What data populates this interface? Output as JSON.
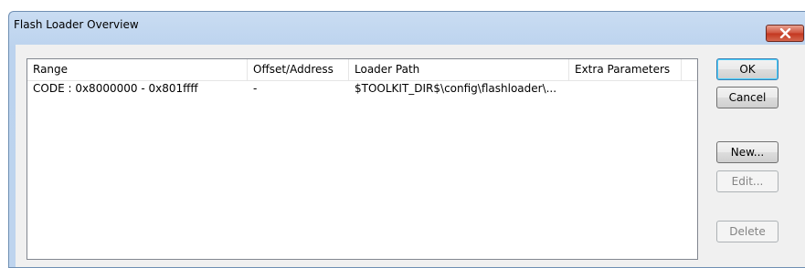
{
  "window": {
    "title": "Flash Loader Overview"
  },
  "list": {
    "columns": [
      "Range",
      "Offset/Address",
      "Loader Path",
      "Extra Parameters"
    ],
    "rows": [
      {
        "range": "CODE : 0x8000000 - 0x801ffff",
        "offset": "-",
        "loader_path": "$TOOLKIT_DIR$\\config\\flashloader\\...",
        "extra": ""
      }
    ]
  },
  "buttons": {
    "ok": "OK",
    "cancel": "Cancel",
    "new": "New...",
    "edit": "Edit...",
    "delete": "Delete"
  },
  "colors": {
    "frame": "#bcd3ee",
    "close_button": "#c4361f"
  }
}
